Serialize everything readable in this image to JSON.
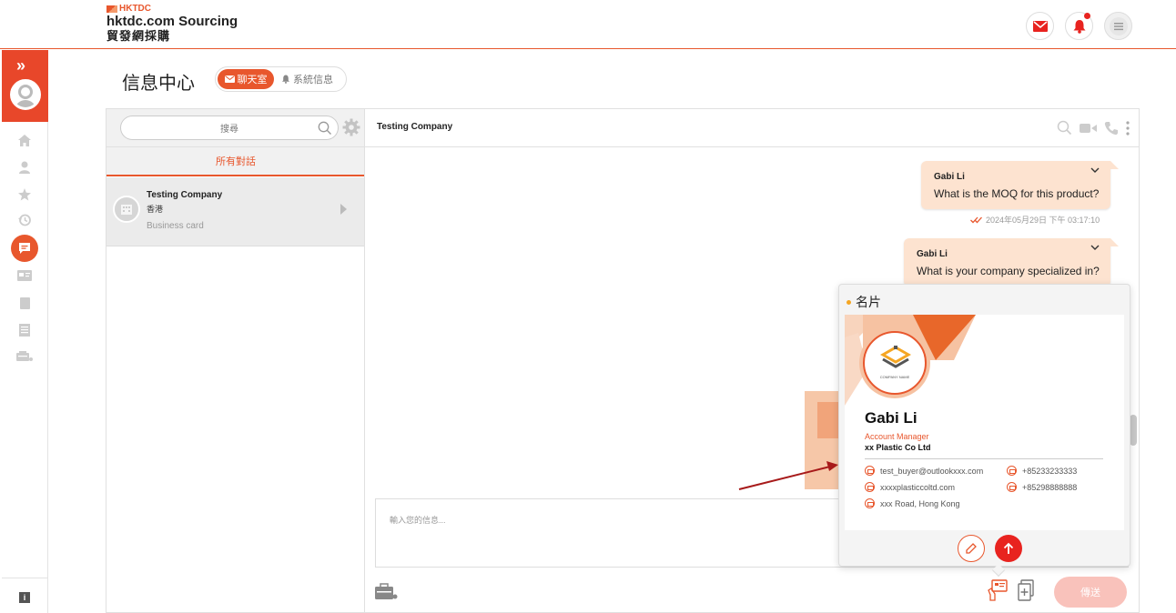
{
  "brand": {
    "logo_small": "HKTDC",
    "title": "hktdc.com Sourcing",
    "subtitle": "貿發網採購"
  },
  "header_icons": [
    "mail-icon",
    "bell-icon",
    "menu-icon"
  ],
  "colors": {
    "accent": "#e8572d",
    "bubble": "#fde3d0",
    "alert": "#e8231f"
  },
  "page": {
    "title": "信息中心",
    "tabs": [
      {
        "label": "聊天室",
        "active": true
      },
      {
        "label": "系統信息",
        "active": false
      }
    ]
  },
  "left_nav": {
    "items": [
      "home-icon",
      "user-icon",
      "star-icon",
      "history-icon",
      "chat-icon",
      "card-icon",
      "folder-icon",
      "list-icon",
      "shop-icon"
    ],
    "footer_icon": "info-icon",
    "footer_label": "i"
  },
  "conversation_list": {
    "search_placeholder": "搜尋",
    "filter_label": "所有對話",
    "items": [
      {
        "name": "Testing Company",
        "location": "香港",
        "preview": "Business card"
      }
    ]
  },
  "chat": {
    "title": "Testing Company",
    "messages": [
      {
        "sender": "Gabi Li",
        "text": "What is the MOQ for this product?",
        "time": "2024年05月29日 下午 03:17:10"
      },
      {
        "sender": "Gabi Li",
        "text": "What is your company specialized in?"
      }
    ],
    "input_placeholder": "輸入您的信息...",
    "send_label": "傳送"
  },
  "business_card": {
    "title": "名片",
    "name": "Gabi Li",
    "role": "Account Manager",
    "company": "xx Plastic Co Ltd",
    "logo_text": "COMPANY NAME",
    "email": "test_buyer@outlookxxx.com",
    "phone1": "+85233233333",
    "website": "xxxxplasticcoltd.com",
    "phone2": "+85298888888",
    "address": "xxx Road, Hong Kong"
  }
}
